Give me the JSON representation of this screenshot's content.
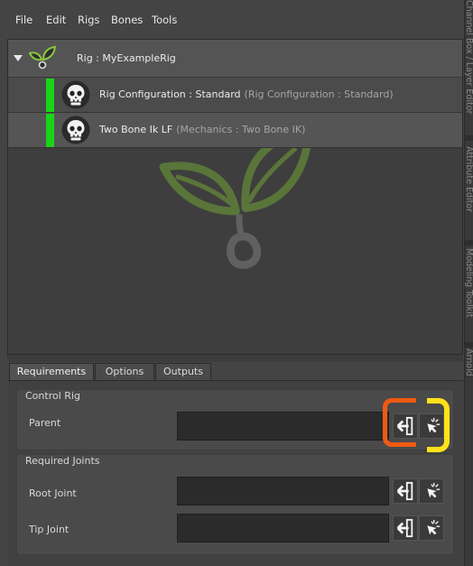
{
  "menu": [
    "File",
    "Edit",
    "Rigs",
    "Bones",
    "Tools"
  ],
  "side_tabs": [
    "Channel Box / Layer Editor",
    "Attribute Editor",
    "Modeling Toolkit",
    "Arnold"
  ],
  "tree": {
    "root_label": "Rig : MyExampleRig",
    "children": [
      {
        "label": "Rig Configuration : Standard",
        "sub": "(Rig Configuration : Standard)"
      },
      {
        "label": "Two Bone Ik LF",
        "sub": "(Mechanics : Two Bone IK)"
      }
    ]
  },
  "tabs": [
    "Requirements",
    "Options",
    "Outputs"
  ],
  "groups": {
    "control_rig": {
      "title": "Control Rig",
      "fields": [
        {
          "label": "Parent",
          "value": ""
        }
      ]
    },
    "required_joints": {
      "title": "Required Joints",
      "fields": [
        {
          "label": "Root Joint",
          "value": ""
        },
        {
          "label": "Tip Joint",
          "value": ""
        }
      ]
    }
  },
  "icons": {
    "leaf": "leaf-icon",
    "skull": "skull-icon",
    "set": "arrow-left-icon",
    "pick": "pick-cursor-icon"
  },
  "colors": {
    "status_green": "#18d418",
    "leaf_green": "#6fa23a",
    "highlight_orange": "#f05a12",
    "highlight_yellow": "#ffe21a"
  }
}
